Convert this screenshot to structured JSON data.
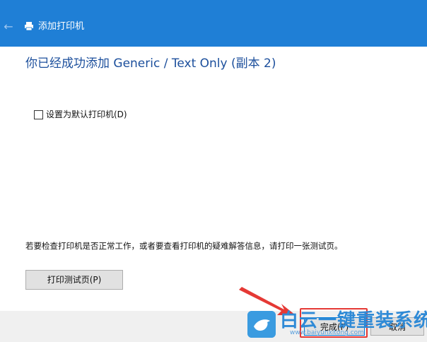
{
  "window": {
    "title": "添加打印机",
    "icons": {
      "back": "back-arrow-icon",
      "app": "printer-icon"
    }
  },
  "main": {
    "heading": "你已经成功添加 Generic / Text Only (副本 2)",
    "default_checkbox": {
      "label": "设置为默认打印机(D)",
      "checked": false
    },
    "info_text": "若要检查打印机是否正常工作，或者要查看打印机的疑难解答信息，请打印一张测试页。",
    "test_page_button": "打印测试页(P)"
  },
  "footer": {
    "finish_button": "完成(F)",
    "cancel_button": "取消"
  },
  "watermark": {
    "brand": "白云一键重装系统",
    "url": "www.baiyunxitong.com"
  },
  "colors": {
    "titlebar": "#1f7fd6",
    "heading": "#1c4f9c",
    "highlight": "#e53935"
  }
}
